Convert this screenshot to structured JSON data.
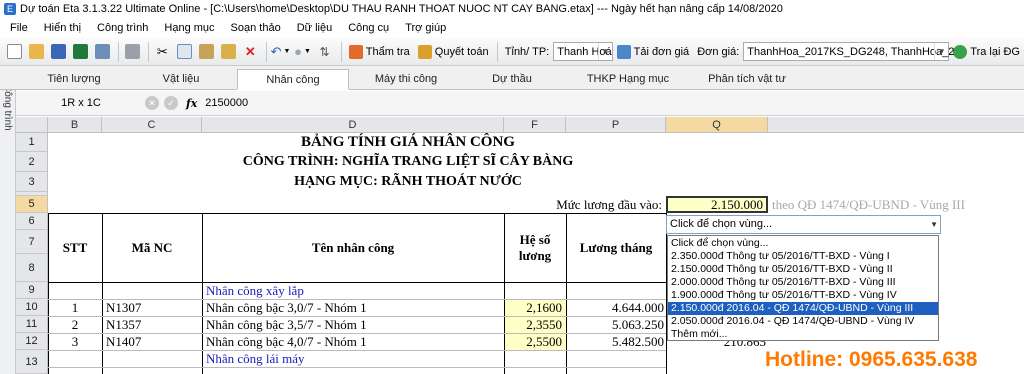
{
  "window": {
    "title": "Dự toán Eta 3.1.3.22 Ultimate Online - [C:\\Users\\home\\Desktop\\DU THAU RANH THOAT NUOC NT CAY BANG.etax]  ---  Ngày hết hạn nâng cấp 14/08/2020"
  },
  "menu": [
    "File",
    "Hiển thị",
    "Công trình",
    "Hạng mục",
    "Soạn thảo",
    "Dữ liệu",
    "Công cụ",
    "Trợ giúp"
  ],
  "toolbar": {
    "tham_tra": "Thẩm tra",
    "quyet_toan": "Quyết toán",
    "tinh_label": "Tỉnh/ TP:",
    "tinh_value": "Thanh Hoá",
    "tai_don_gia": "Tải đơn giá",
    "don_gia_label": "Đơn giá:",
    "don_gia_value": "ThanhHoa_2017KS_DG248, ThanhHoa_2",
    "tra_lai": "Tra lại ĐG"
  },
  "side_tab": "Công trình",
  "tabs": [
    "Tiên lượng",
    "Vật liệu",
    "Nhân công",
    "Máy thi công",
    "Dự thầu",
    "THKP Hạng mục",
    "Phân tích vật tư"
  ],
  "active_tab": "Nhân công",
  "formula": {
    "cell_ref": "1R x 1C",
    "fx": "fx",
    "value": "2150000"
  },
  "columns": [
    "B",
    "C",
    "D",
    "F",
    "P",
    "Q"
  ],
  "rows": [
    "1",
    "2",
    "3",
    "4",
    "5",
    "6",
    "7",
    "8",
    "9",
    "10",
    "11",
    "12",
    "13"
  ],
  "sheet": {
    "title1": "BẢNG TÍNH GIÁ NHÂN CÔNG",
    "title2": "CÔNG TRÌNH: NGHĨA TRANG LIỆT SĨ CÂY BÀNG",
    "title3": "HẠNG MỤC: RÃNH THOÁT NƯỚC",
    "muc_luong_label": "Mức lương đầu vào:",
    "muc_luong_value": "2.150.000",
    "muc_luong_note": "theo QĐ 1474/QĐ-UBND - Vùng III",
    "headers": {
      "stt": "STT",
      "ma": "Mã NC",
      "ten": "Tên nhân công",
      "he_so": "Hệ số lương",
      "luong": "Lương tháng"
    },
    "group1": "Nhân công xây lắp",
    "items": [
      {
        "stt": "1",
        "ma": "N1307",
        "ten": "Nhân công bậc 3,0/7 - Nhóm 1",
        "he_so": "2,1600",
        "luong": "4.644.000"
      },
      {
        "stt": "2",
        "ma": "N1357",
        "ten": "Nhân công bậc 3,5/7 - Nhóm 1",
        "he_so": "2,3550",
        "luong": "5.063.250"
      },
      {
        "stt": "3",
        "ma": "N1407",
        "ten": "Nhân công bậc 4,0/7 - Nhóm 1",
        "he_so": "2,5500",
        "luong": "5.482.500",
        "q": "210.865"
      }
    ],
    "group2": "Nhân công lái máy"
  },
  "dropdown": {
    "combo": "Click để chọn vùng...",
    "options": [
      "Click để chọn vùng...",
      "2.350.000đ    Thông tư 05/2016/TT-BXD - Vùng I",
      "2.150.000đ    Thông tư 05/2016/TT-BXD - Vùng II",
      "2.000.000đ    Thông tư 05/2016/TT-BXD - Vùng III",
      "1.900.000đ    Thông tư 05/2016/TT-BXD - Vùng IV",
      "2.150.000đ    2016.04 - QĐ 1474/QĐ-UBND - Vùng III",
      "2.050.000đ    2016.04 - QĐ 1474/QĐ-UBND - Vùng IV",
      "Thêm mới..."
    ],
    "selected_index": 5
  },
  "hotline": "Hotline: 0965.635.638"
}
